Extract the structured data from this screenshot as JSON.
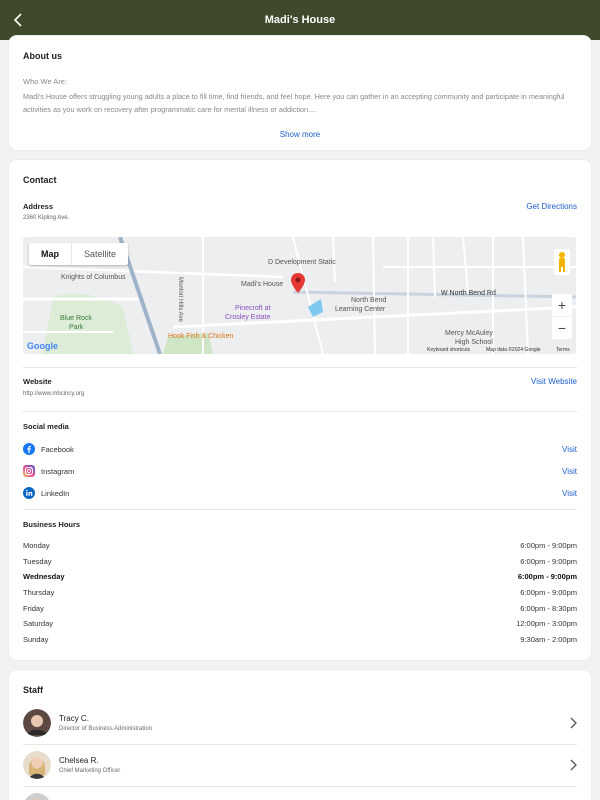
{
  "header": {
    "title": "Madi's House"
  },
  "about": {
    "title": "About us",
    "label": "Who We Are:",
    "text": "Madi's House offers struggling young adults a place to fill time, find friends, and feel hope. Here you can gather in an accepting community and participate in meaningful activities as you work on recovery after programmatic care for mental illness or addiction....",
    "show_more": "Show more"
  },
  "contact": {
    "title": "Contact",
    "address_label": "Address",
    "address": "2360 Kipling Ave.",
    "directions": "Get Directions",
    "map": {
      "map_tab": "Map",
      "satellite_tab": "Satellite",
      "labels": {
        "madis": "Madi's House",
        "pinecroft": "Pinecroft at",
        "crosley": "Crosley Estate",
        "knights": "Knights of Columbus",
        "bluerock": "Blue Rock",
        "park": "Park",
        "hook": "Hook Fish & Chicken",
        "ddev": "D Development Static",
        "northbend": "North Bend",
        "learning": "Learning Center",
        "wnorthbend": "W North Bend Rd",
        "mercy": "Mercy McAuley",
        "highschool": "High School",
        "montfort": "Monfort Hills Ave",
        "google": "Google",
        "shortcuts": "Keyboard shortcuts",
        "mapdata": "Map data ©2024 Google",
        "terms": "Terms"
      }
    },
    "website_label": "Website",
    "website_url": "http://www.mhcincy.org",
    "visit_website": "Visit Website",
    "social_label": "Social media",
    "social": [
      {
        "name": "Facebook",
        "visit": "Visit"
      },
      {
        "name": "Instagram",
        "visit": "Visit"
      },
      {
        "name": "LinkedIn",
        "visit": "Visit"
      }
    ],
    "hours_label": "Business Hours",
    "hours": [
      {
        "day": "Monday",
        "time": "6:00pm - 9:00pm"
      },
      {
        "day": "Tuesday",
        "time": "6:00pm - 9:00pm"
      },
      {
        "day": "Wednesday",
        "time": "6:00pm - 9:00pm"
      },
      {
        "day": "Thursday",
        "time": "6:00pm - 9:00pm"
      },
      {
        "day": "Friday",
        "time": "6:00pm - 8:30pm"
      },
      {
        "day": "Saturday",
        "time": "12:00pm - 3:00pm"
      },
      {
        "day": "Sunday",
        "time": "9:30am - 2:00pm"
      }
    ],
    "current_day": "Wednesday"
  },
  "staff": {
    "title": "Staff",
    "members": [
      {
        "name": "Tracy C.",
        "role": "Director of Business Administration"
      },
      {
        "name": "Chelsea R.",
        "role": "Chief Marketing Officer"
      }
    ]
  },
  "colors": {
    "topbar": "#3e4a2b",
    "link": "#1a5fc9",
    "pin": "#e53935",
    "facebook": "#1877f2",
    "instagram": "#d6249f",
    "linkedin": "#0a66c2"
  }
}
